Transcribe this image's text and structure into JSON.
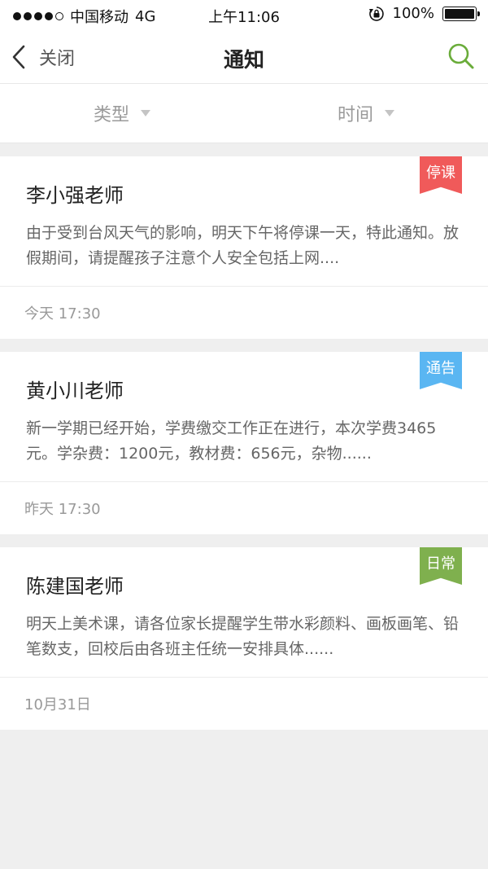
{
  "statusbar": {
    "carrier": "中国移动",
    "network": "4G",
    "time": "上午11:06",
    "battery": "100%"
  },
  "navbar": {
    "back_label": "关闭",
    "title": "通知",
    "search_icon": "search-icon"
  },
  "filters": [
    {
      "label": "类型"
    },
    {
      "label": "时间"
    }
  ],
  "notices": [
    {
      "teacher": "李小强老师",
      "content": "由于受到台风天气的影响，明天下午将停课一天，特此通知。放假期间，请提醒孩子注意个人安全包括上网....",
      "time": "今天 17:30",
      "tag": "停课",
      "tag_color": "#f05a5a"
    },
    {
      "teacher": "黄小川老师",
      "content": "新一学期已经开始，学费缴交工作正在进行，本次学费3465元。学杂费：1200元，教材费：656元，杂物......",
      "time": "昨天 17:30",
      "tag": "通告",
      "tag_color": "#5ab6f2"
    },
    {
      "teacher": "陈建国老师",
      "content": "明天上美术课，请各位家长提醒学生带水彩颜料、画板画笔、铅笔数支，回校后由各班主任统一安排具体......",
      "time": "10月31日",
      "tag": "日常",
      "tag_color": "#7fb04e"
    }
  ],
  "colors": {
    "accent": "#6aac3a",
    "background": "#efefef"
  }
}
